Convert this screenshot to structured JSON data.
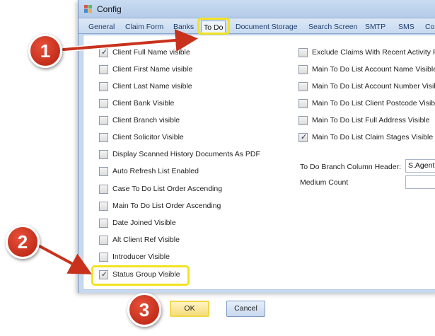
{
  "window": {
    "title": "Config"
  },
  "tabs": [
    {
      "label": "General"
    },
    {
      "label": "Claim Form"
    },
    {
      "label": "Banks"
    },
    {
      "label": "To Do"
    },
    {
      "label": "Document Storage"
    },
    {
      "label": "Search Screen"
    },
    {
      "label": "SMTP"
    },
    {
      "label": "SMS"
    },
    {
      "label": "Co"
    }
  ],
  "left_options": [
    {
      "label": "Client Full Name visible",
      "checked": true
    },
    {
      "label": "Client First Name visible",
      "checked": false
    },
    {
      "label": "Client Last Name visible",
      "checked": false
    },
    {
      "label": "Client Bank Visible",
      "checked": false
    },
    {
      "label": "Client Branch visible",
      "checked": false
    },
    {
      "label": "Client Solicitor Visible",
      "checked": false
    },
    {
      "label": "Display Scanned History Documents As PDF",
      "checked": false
    },
    {
      "label": "Auto Refresh List Enabled",
      "checked": false
    },
    {
      "label": "Case To Do List Order Ascending",
      "checked": false
    },
    {
      "label": "Main To Do List Order Ascending",
      "checked": false
    },
    {
      "label": "Date Joined Visible",
      "checked": false
    },
    {
      "label": "Alt Client Ref Visible",
      "checked": false
    },
    {
      "label": "Introducer Visible",
      "checked": false
    },
    {
      "label": "Status Group  Visible",
      "checked": true
    }
  ],
  "right_options": [
    {
      "label": "Exclude Claims With Recent Activity Fr",
      "checked": false
    },
    {
      "label": "Main To Do List Account Name Visible",
      "checked": false
    },
    {
      "label": "Main To Do List Account Number Visib",
      "checked": false
    },
    {
      "label": "Main To Do List Client Postcode Visibl",
      "checked": false
    },
    {
      "label": "Main To Do List Full Address Visible",
      "checked": false
    },
    {
      "label": "Main To Do List Claim Stages Visible",
      "checked": true
    }
  ],
  "fields": {
    "branch_header_label": "To Do Branch Column Header:",
    "branch_header_value": "S.Agent",
    "medium_count_label": "Medium Count",
    "medium_count_value": ""
  },
  "buttons": {
    "ok": "OK",
    "cancel": "Cancel"
  },
  "callouts": {
    "one": "1",
    "two": "2",
    "three": "3"
  },
  "colors": {
    "highlight": "#f2e321",
    "callout": "#c8321c"
  }
}
